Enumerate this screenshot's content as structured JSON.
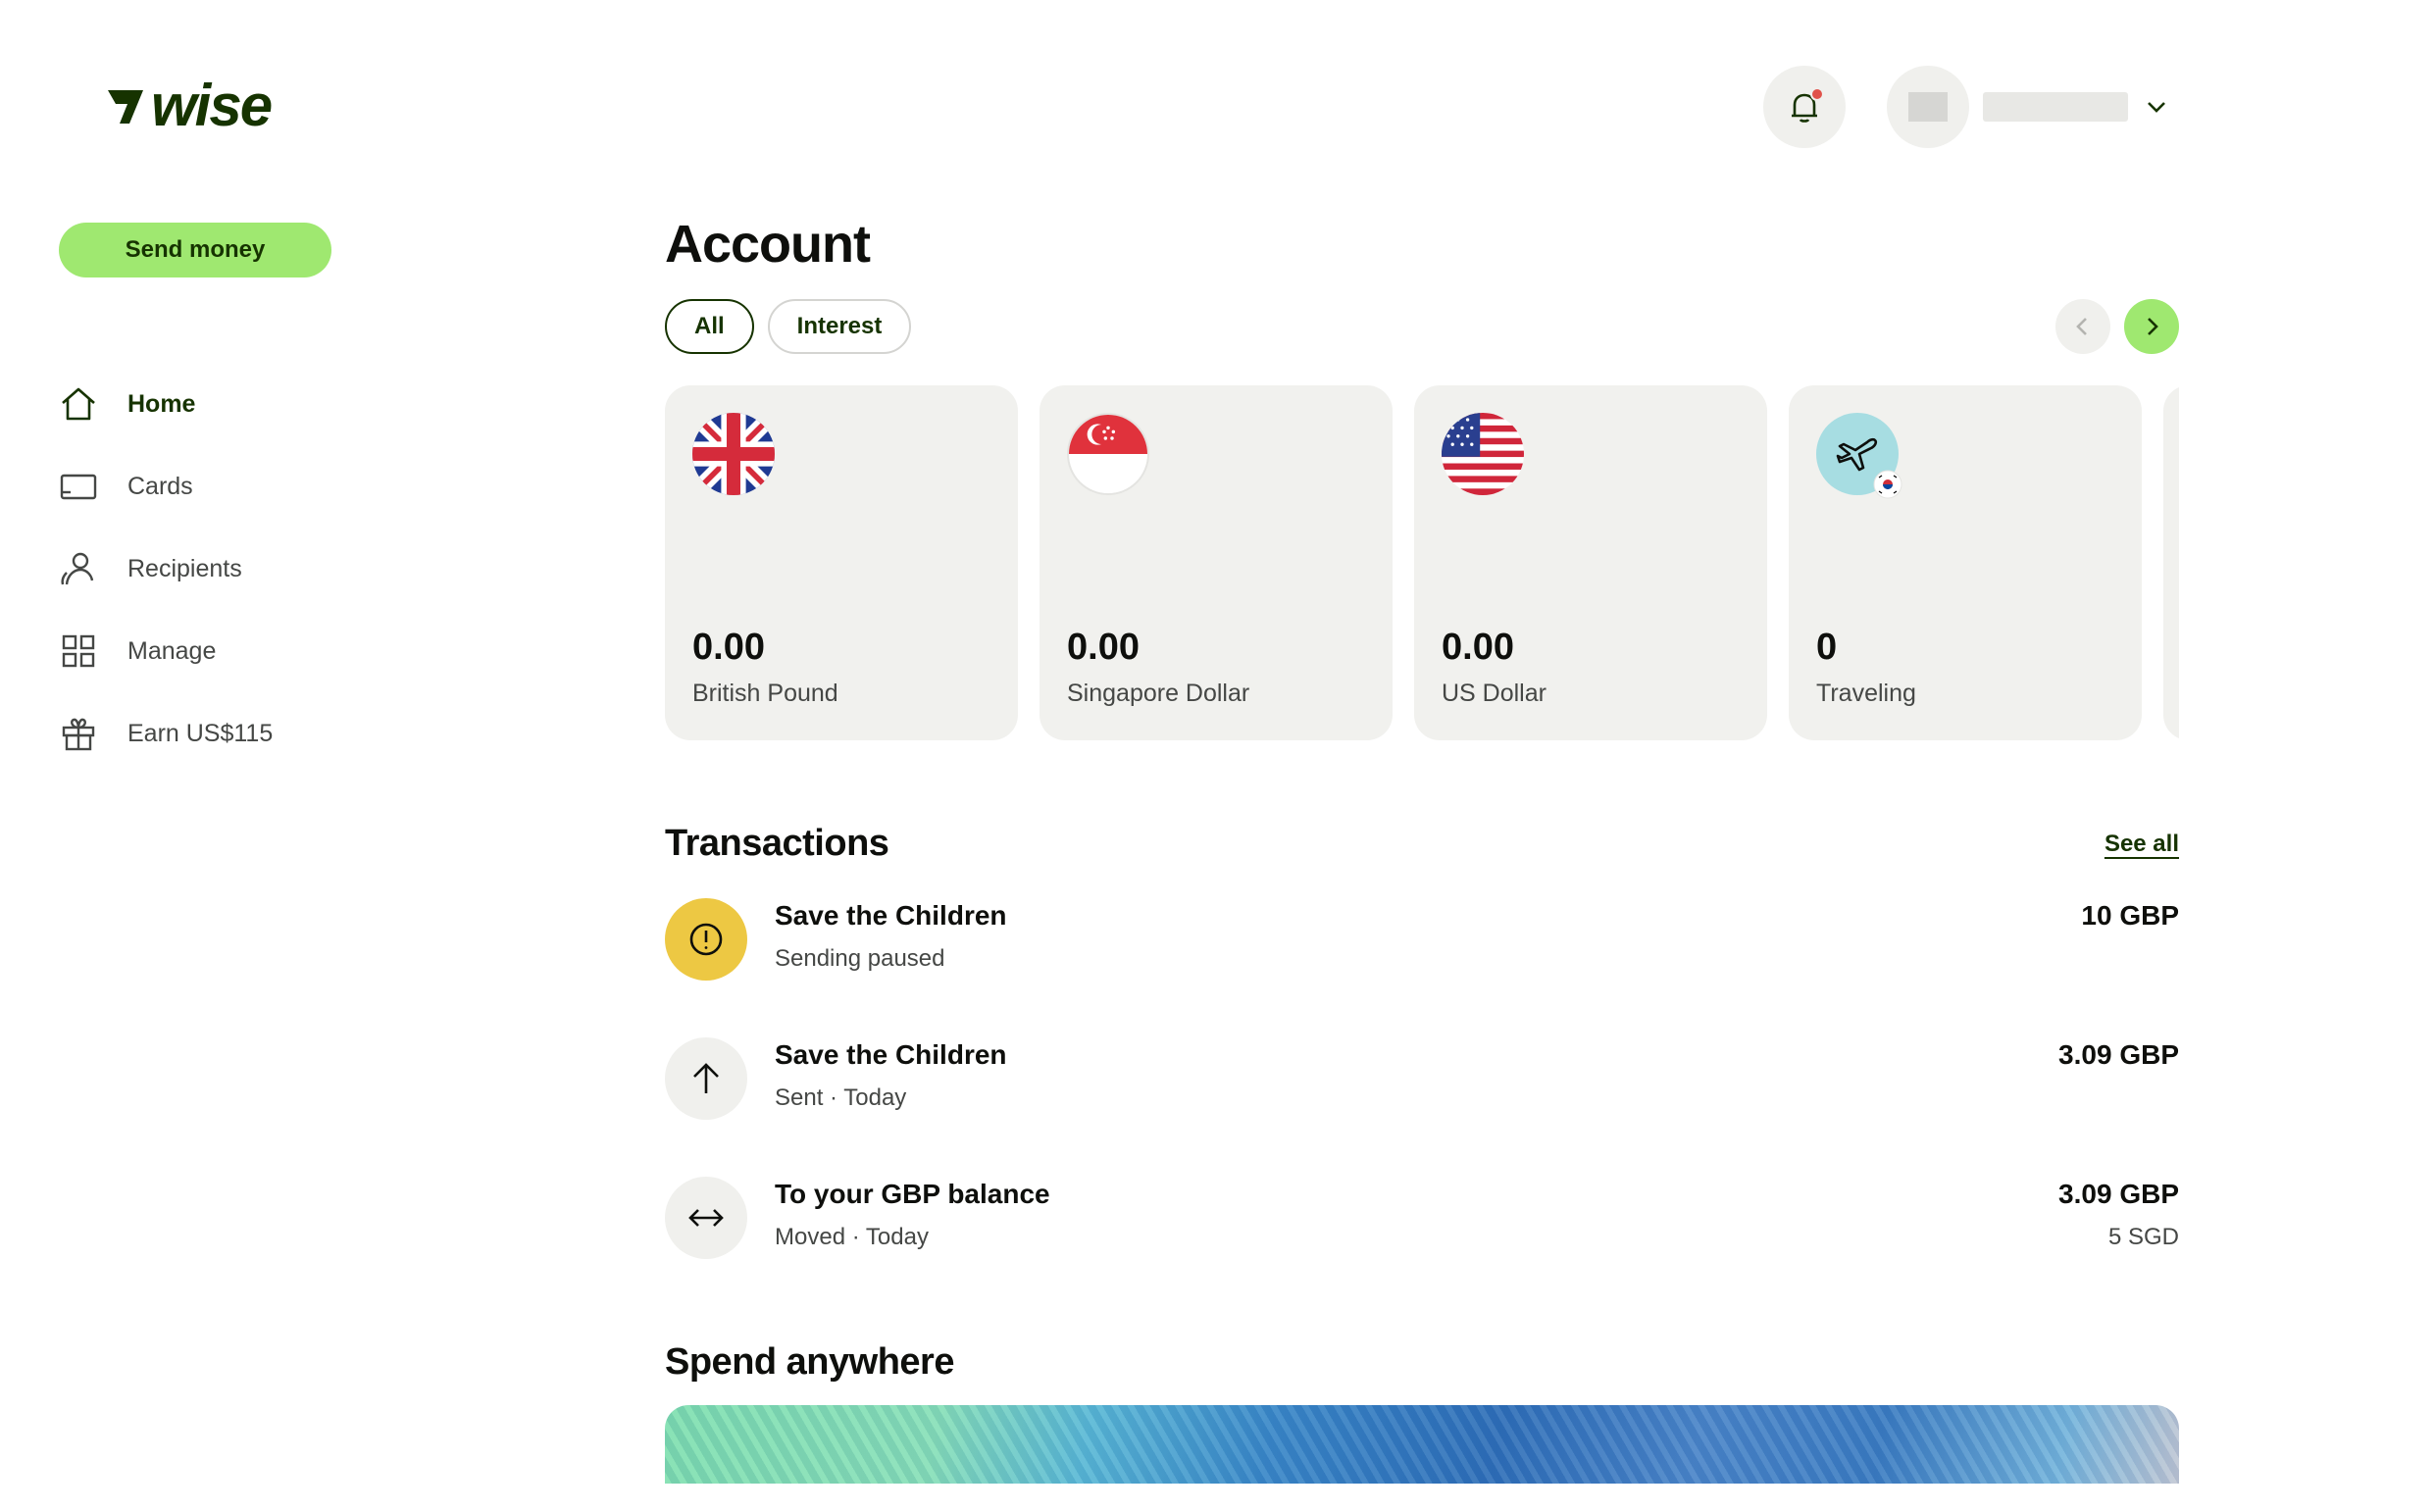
{
  "brand": {
    "name": "wise",
    "accent": "#9fe870",
    "dark": "#163300"
  },
  "sidebar": {
    "send_label": "Send money",
    "items": [
      {
        "label": "Home",
        "icon": "home-icon",
        "active": true
      },
      {
        "label": "Cards",
        "icon": "card-icon",
        "active": false
      },
      {
        "label": "Recipients",
        "icon": "recipients-icon",
        "active": false
      },
      {
        "label": "Manage",
        "icon": "grid-icon",
        "active": false
      },
      {
        "label": "Earn US$115",
        "icon": "gift-icon",
        "active": false
      }
    ]
  },
  "header": {
    "notification_icon": "bell-icon",
    "has_notification": true
  },
  "account": {
    "title": "Account",
    "filters": [
      {
        "label": "All",
        "active": true
      },
      {
        "label": "Interest",
        "active": false
      }
    ],
    "balances": [
      {
        "amount": "0.00",
        "name": "British Pound",
        "flag": "uk-flag-icon"
      },
      {
        "amount": "0.00",
        "name": "Singapore Dollar",
        "flag": "sg-flag-icon"
      },
      {
        "amount": "0.00",
        "name": "US Dollar",
        "flag": "us-flag-icon"
      },
      {
        "amount": "0",
        "name": "Traveling",
        "flag": "plane-jar-icon"
      }
    ]
  },
  "transactions": {
    "title": "Transactions",
    "see_all": "See all",
    "items": [
      {
        "title": "Save the Children",
        "subtitle": "Sending paused",
        "amount": "10 GBP",
        "secondary": "",
        "icon": "alert-icon"
      },
      {
        "title": "Save the Children",
        "subtitle": "Sent · Today",
        "amount": "3.09 GBP",
        "secondary": "",
        "icon": "arrow-up-icon"
      },
      {
        "title": "To your GBP balance",
        "subtitle": "Moved · Today",
        "amount": "3.09 GBP",
        "secondary": "5 SGD",
        "icon": "arrows-horizontal-icon"
      }
    ]
  },
  "spend": {
    "title": "Spend anywhere"
  }
}
